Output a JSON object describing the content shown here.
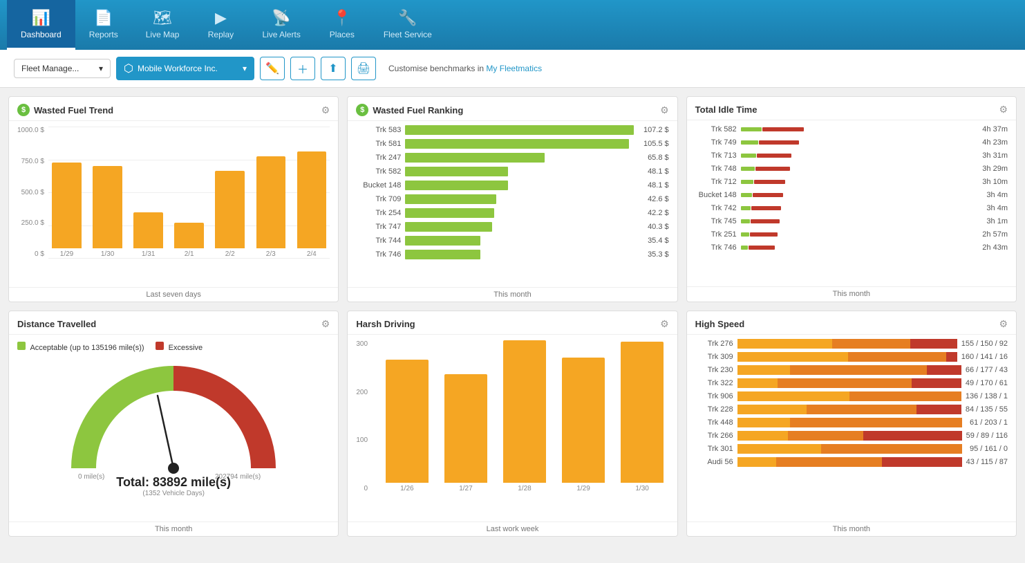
{
  "nav": {
    "items": [
      {
        "id": "dashboard",
        "label": "Dashboard",
        "icon": "📊",
        "active": true
      },
      {
        "id": "reports",
        "label": "Reports",
        "icon": "📄",
        "active": false
      },
      {
        "id": "livemap",
        "label": "Live Map",
        "icon": "🗺",
        "active": false
      },
      {
        "id": "replay",
        "label": "Replay",
        "icon": "▶",
        "active": false
      },
      {
        "id": "livealerts",
        "label": "Live Alerts",
        "icon": "📡",
        "active": false
      },
      {
        "id": "places",
        "label": "Places",
        "icon": "📍",
        "active": false
      },
      {
        "id": "fleetservice",
        "label": "Fleet Service",
        "icon": "🔧",
        "active": false
      }
    ]
  },
  "toolbar": {
    "view_label": "Fleet Manage...",
    "company_name": "Mobile Workforce Inc.",
    "customise_text": "Customise benchmarks in",
    "customise_link": "My Fleetmatics"
  },
  "panels": {
    "wasted_fuel_trend": {
      "title": "Wasted Fuel Trend",
      "footer": "Last seven days",
      "y_labels": [
        "1000.0 $",
        "750.0 $",
        "500.0 $",
        "250.0 $",
        "0 $"
      ],
      "bars": [
        {
          "label": "1/29",
          "value": 690,
          "max": 1000
        },
        {
          "label": "1/30",
          "value": 660,
          "max": 1000
        },
        {
          "label": "1/31",
          "value": 290,
          "max": 1000
        },
        {
          "label": "2/1",
          "value": 205,
          "max": 1000
        },
        {
          "label": "2/2",
          "value": 620,
          "max": 1000
        },
        {
          "label": "2/3",
          "value": 740,
          "max": 1000
        },
        {
          "label": "2/4",
          "value": 780,
          "max": 1000
        }
      ]
    },
    "wasted_fuel_ranking": {
      "title": "Wasted Fuel Ranking",
      "footer": "This month",
      "rows": [
        {
          "label": "Trk 583",
          "value": "107.2 $",
          "pct": 100
        },
        {
          "label": "Trk 581",
          "value": "105.5 $",
          "pct": 98
        },
        {
          "label": "Trk 247",
          "value": "65.8 $",
          "pct": 61
        },
        {
          "label": "Trk 582",
          "value": "48.1 $",
          "pct": 45
        },
        {
          "label": "Bucket 148",
          "value": "48.1 $",
          "pct": 45
        },
        {
          "label": "Trk 709",
          "value": "42.6 $",
          "pct": 40
        },
        {
          "label": "Trk 254",
          "value": "42.2 $",
          "pct": 39
        },
        {
          "label": "Trk 747",
          "value": "40.3 $",
          "pct": 38
        },
        {
          "label": "Trk 744",
          "value": "35.4 $",
          "pct": 33
        },
        {
          "label": "Trk 746",
          "value": "35.3 $",
          "pct": 33
        }
      ]
    },
    "total_idle_time": {
      "title": "Total Idle Time",
      "footer": "This month",
      "rows": [
        {
          "label": "Trk 582",
          "value": "4h 37m",
          "green": 30,
          "red": 60
        },
        {
          "label": "Trk 749",
          "value": "4h 23m",
          "green": 25,
          "red": 58
        },
        {
          "label": "Trk 713",
          "value": "3h 31m",
          "green": 22,
          "red": 50
        },
        {
          "label": "Trk 748",
          "value": "3h 29m",
          "green": 20,
          "red": 50
        },
        {
          "label": "Trk 712",
          "value": "3h 10m",
          "green": 18,
          "red": 45
        },
        {
          "label": "Bucket 148",
          "value": "3h 4m",
          "green": 16,
          "red": 44
        },
        {
          "label": "Trk 742",
          "value": "3h 4m",
          "green": 14,
          "red": 43
        },
        {
          "label": "Trk 745",
          "value": "3h 1m",
          "green": 13,
          "red": 42
        },
        {
          "label": "Trk 251",
          "value": "2h 57m",
          "green": 12,
          "red": 40
        },
        {
          "label": "Trk 746",
          "value": "2h 43m",
          "green": 10,
          "red": 38
        }
      ]
    },
    "distance_travelled": {
      "title": "Distance Travelled",
      "footer": "This month",
      "legend_green": "Acceptable (up to 135196 mile(s))",
      "legend_red": "Excessive",
      "total": "83892 mile(s)",
      "sub": "(1352 Vehicle Days)",
      "total_label": "Total:",
      "min_label": "0 mile(s)",
      "max_label": "202794 mile(s)",
      "gauge_pct": 41
    },
    "harsh_driving": {
      "title": "Harsh Driving",
      "footer": "Last work week",
      "y_labels": [
        "300",
        "200",
        "100",
        "0"
      ],
      "bars": [
        {
          "label": "1/26",
          "value": 255,
          "max": 300
        },
        {
          "label": "1/27",
          "value": 225,
          "max": 300
        },
        {
          "label": "1/28",
          "value": 295,
          "max": 300
        },
        {
          "label": "1/29",
          "value": 258,
          "max": 300
        },
        {
          "label": "1/30",
          "value": 292,
          "max": 300
        }
      ]
    },
    "high_speed": {
      "title": "High Speed",
      "footer": "This month",
      "rows": [
        {
          "label": "Trk 276",
          "value": "155 / 150 / 92",
          "y": 55,
          "o": 45,
          "r": 27
        },
        {
          "label": "Trk 309",
          "value": "160 / 141 / 16",
          "y": 52,
          "o": 46,
          "r": 5
        },
        {
          "label": "Trk 230",
          "value": "66 / 177 / 43",
          "y": 23,
          "o": 60,
          "r": 15
        },
        {
          "label": "Trk 322",
          "value": "49 / 170 / 61",
          "y": 17,
          "o": 57,
          "r": 21
        },
        {
          "label": "Trk 906",
          "value": "136 / 138 / 1",
          "y": 49,
          "o": 49,
          "r": 0
        },
        {
          "label": "Trk 228",
          "value": "84 / 135 / 55",
          "y": 31,
          "o": 49,
          "r": 20
        },
        {
          "label": "Trk 448",
          "value": "61 / 203 / 1",
          "y": 23,
          "o": 75,
          "r": 0
        },
        {
          "label": "Trk 266",
          "value": "59 / 89 / 116",
          "y": 22,
          "o": 33,
          "r": 43
        },
        {
          "label": "Trk 301",
          "value": "95 / 161 / 0",
          "y": 37,
          "o": 62,
          "r": 0
        },
        {
          "label": "Audi 56",
          "value": "43 / 115 / 87",
          "y": 17,
          "o": 46,
          "r": 35
        }
      ]
    }
  }
}
